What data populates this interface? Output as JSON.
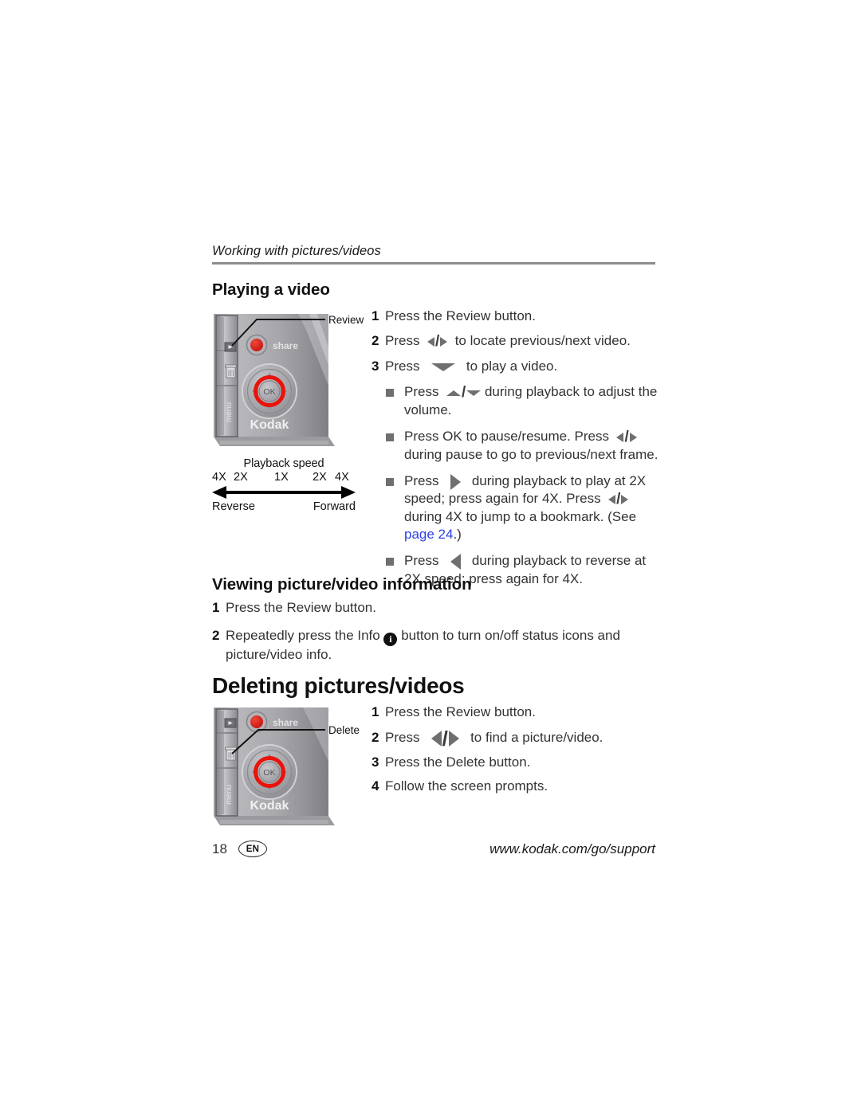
{
  "document": {
    "running_header": "Working with pictures/videos"
  },
  "section_playing": {
    "heading": "Playing a video",
    "steps": [
      {
        "num": "1",
        "before": "Press the Review button.",
        "glyph": "",
        "after": ""
      },
      {
        "num": "2",
        "before": "Press",
        "glyph": "left-right-arrows",
        "after": "to locate previous/next video."
      },
      {
        "num": "3",
        "before": "Press",
        "glyph": "down-arrow-wide",
        "after": "to play a video."
      }
    ],
    "sub_items": [
      {
        "before": "Press",
        "glyph": "up-down-arrows",
        "after": "during playback to adjust the volume."
      },
      {
        "before": "Press OK to pause/resume. Press",
        "glyph": "left-right-arrows",
        "after": "during pause to go to previous/next frame."
      },
      {
        "before": "Press",
        "glyph": "right-arrow-big",
        "after": "during playback to play at 2X speed; press again for 4X. Press",
        "glyph2": "left-right-arrows",
        "after2": "during 4X to jump to a bookmark. (See ",
        "link": "page 24",
        "after3": ".)"
      },
      {
        "before": "Press",
        "glyph": "left-arrow-big",
        "after": "during playback to reverse at 2X speed; press again for 4X."
      }
    ]
  },
  "section_viewing": {
    "heading": "Viewing picture/video information",
    "steps": [
      {
        "num": "1",
        "text": "Press the Review button."
      },
      {
        "num": "2",
        "before": "Repeatedly press the Info",
        "glyph": "info-icon",
        "after": "button to turn on/off status icons and picture/video info."
      }
    ]
  },
  "section_deleting": {
    "heading": "Deleting pictures/videos",
    "steps": [
      {
        "num": "1",
        "before": "Press the Review button.",
        "glyph": "",
        "after": ""
      },
      {
        "num": "2",
        "before": "Press",
        "glyph": "left-right-arrows-large",
        "after": "to find a picture/video."
      },
      {
        "num": "3",
        "before": "Press the Delete button.",
        "glyph": "",
        "after": ""
      },
      {
        "num": "4",
        "before": "Follow the screen prompts.",
        "glyph": "",
        "after": ""
      }
    ]
  },
  "speed_diagram": {
    "title": "Playback speed",
    "ticks": [
      "4X",
      "2X",
      "1X",
      "2X",
      "4X"
    ],
    "left_label": "Reverse",
    "right_label": "Forward"
  },
  "camera_top": {
    "callout": "Review",
    "share_label": "share",
    "ok_label": "OK",
    "brand": "Kodak",
    "menu_label": "menu"
  },
  "camera_bottom": {
    "callout": "Delete",
    "share_label": "share",
    "ok_label": "OK",
    "brand": "Kodak",
    "menu_label": "menu"
  },
  "footer": {
    "page_number": "18",
    "language": "EN",
    "url": "www.kodak.com/go/support"
  },
  "colors": {
    "link": "#2b3fe8",
    "rule": "#8c8c8c",
    "bullet": "#6f6f6f",
    "accent_red": "#e01b1b"
  }
}
